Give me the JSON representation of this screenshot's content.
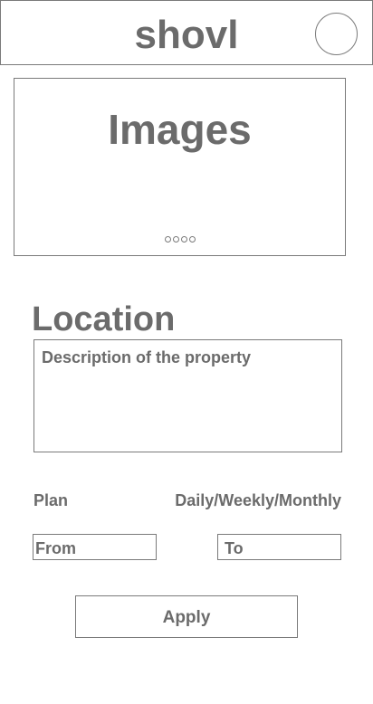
{
  "header": {
    "title": "shovl",
    "avatar_icon": "avatar-circle-icon"
  },
  "carousel": {
    "title": "Images",
    "dot_count": 4,
    "dot_icon": "carousel-dot-icon"
  },
  "listing": {
    "location": "Location",
    "description_placeholder": "Description of the property"
  },
  "plan": {
    "label": "Plan",
    "period": "Daily/Weekly/Monthly",
    "from_placeholder": "From",
    "to_placeholder": "To"
  },
  "actions": {
    "apply_label": "Apply"
  }
}
